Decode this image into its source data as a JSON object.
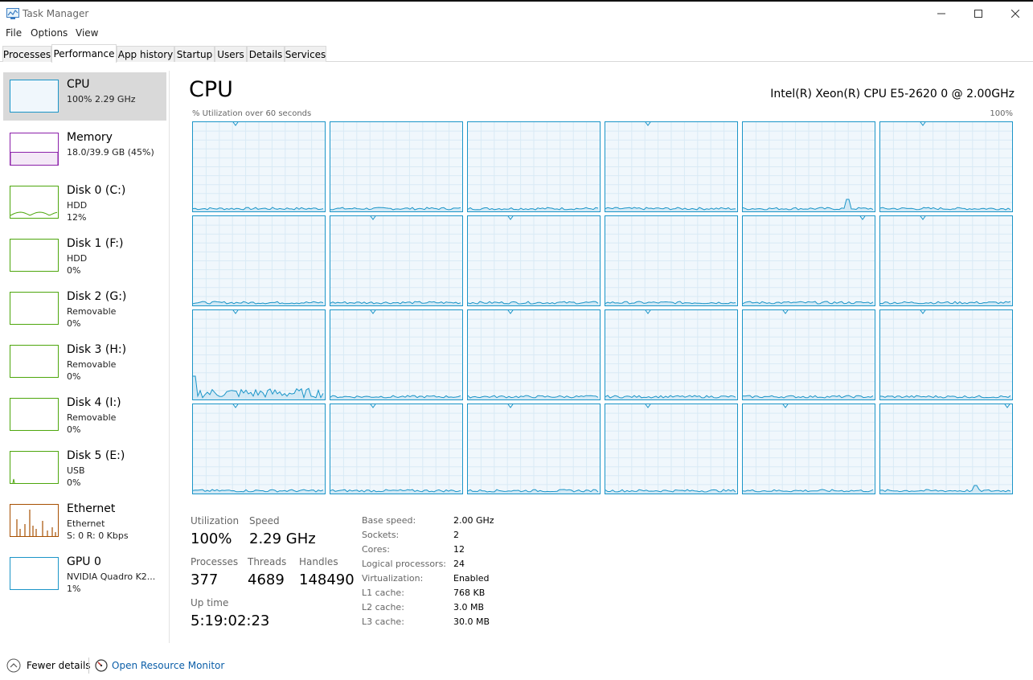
{
  "window": {
    "title": "Task Manager"
  },
  "menu": {
    "file": "File",
    "options": "Options",
    "view": "View"
  },
  "tabs": [
    {
      "label": "Processes"
    },
    {
      "label": "Performance"
    },
    {
      "label": "App history"
    },
    {
      "label": "Startup"
    },
    {
      "label": "Users"
    },
    {
      "label": "Details"
    },
    {
      "label": "Services"
    }
  ],
  "active_tab": "Performance",
  "sidebar": {
    "items": [
      {
        "name": "CPU",
        "line2": "100% 2.29 GHz",
        "line3": "",
        "color": "#1b95c8",
        "selected": true
      },
      {
        "name": "Memory",
        "line2": "18.0/39.9 GB (45%)",
        "line3": "",
        "color": "#8b1fa9",
        "fill": 0.45
      },
      {
        "name": "Disk 0 (C:)",
        "line2": "HDD",
        "line3": "12%",
        "color": "#4da60c"
      },
      {
        "name": "Disk 1 (F:)",
        "line2": "HDD",
        "line3": "0%",
        "color": "#4da60c"
      },
      {
        "name": "Disk 2 (G:)",
        "line2": "Removable",
        "line3": "0%",
        "color": "#4da60c"
      },
      {
        "name": "Disk 3 (H:)",
        "line2": "Removable",
        "line3": "0%",
        "color": "#4da60c"
      },
      {
        "name": "Disk 4 (I:)",
        "line2": "Removable",
        "line3": "0%",
        "color": "#4da60c"
      },
      {
        "name": "Disk 5 (E:)",
        "line2": "USB",
        "line3": "0%",
        "color": "#4da60c"
      },
      {
        "name": "Ethernet",
        "line2": "Ethernet",
        "line3": "S: 0 R: 0 Kbps",
        "color": "#a74f01"
      },
      {
        "name": "GPU 0",
        "line2": "NVIDIA Quadro K2...",
        "line3": "1%",
        "color": "#1b95c8"
      }
    ]
  },
  "main": {
    "title": "CPU",
    "model": "Intel(R) Xeon(R) CPU E5-2620 0 @ 2.00GHz",
    "graph_label": "% Utilization over 60 seconds",
    "graph_max": "100%",
    "logical_processors_count": 24
  },
  "stats": {
    "utilization_label": "Utilization",
    "utilization_value": "100%",
    "speed_label": "Speed",
    "speed_value": "2.29 GHz",
    "processes_label": "Processes",
    "processes_value": "377",
    "threads_label": "Threads",
    "threads_value": "4689",
    "handles_label": "Handles",
    "handles_value": "148490",
    "uptime_label": "Up time",
    "uptime_value": "5:19:02:23"
  },
  "specs": [
    {
      "label": "Base speed:",
      "value": "2.00 GHz"
    },
    {
      "label": "Sockets:",
      "value": "2"
    },
    {
      "label": "Cores:",
      "value": "12"
    },
    {
      "label": "Logical processors:",
      "value": "24"
    },
    {
      "label": "Virtualization:",
      "value": "Enabled"
    },
    {
      "label": "L1 cache:",
      "value": "768 KB"
    },
    {
      "label": "L2 cache:",
      "value": "3.0 MB"
    },
    {
      "label": "L3 cache:",
      "value": "30.0 MB"
    }
  ],
  "footer": {
    "fewer_details": "Fewer details",
    "open_resource_monitor": "Open Resource Monitor"
  },
  "colors": {
    "cpu": "#1b95c8",
    "memory": "#8b1fa9",
    "disk": "#4da60c",
    "ethernet": "#a74f01",
    "link": "#0b5ea8"
  }
}
